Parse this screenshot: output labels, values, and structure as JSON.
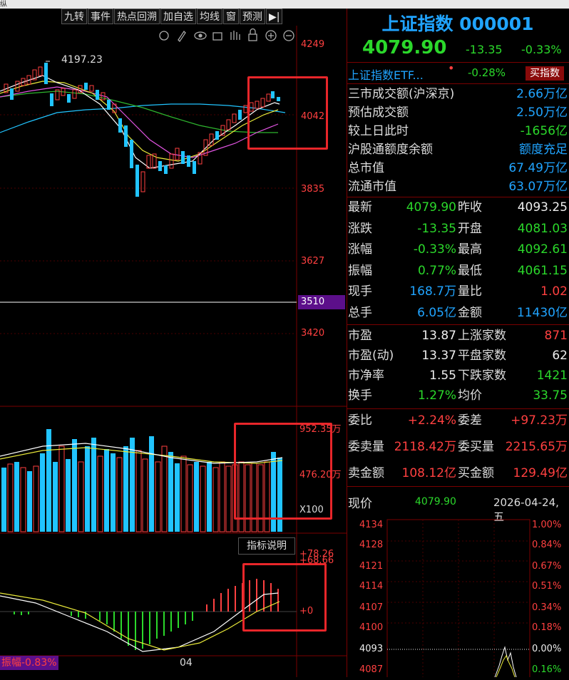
{
  "window": {
    "title_fragment": "纵"
  },
  "toolbar": {
    "buttons": [
      "九转",
      "事件",
      "热点回溯",
      "加自选",
      "均线",
      "窗",
      "预测"
    ],
    "arrow": "▶|"
  },
  "chart": {
    "peak_label": "4197.23",
    "price_axis": [
      "4249",
      "4042",
      "3835",
      "3627",
      "3510",
      "3420"
    ],
    "volume_axis": [
      "952.35万",
      "476.20万",
      "X100"
    ],
    "macd_axis": [
      "+78.26",
      "+68.66",
      "+0"
    ],
    "indicator_button": "指标说明",
    "amplitude_label": "振幅-0.83%",
    "date_label": "04",
    "tool_icons": [
      "gear-icon",
      "pen-icon",
      "eye-icon",
      "basket-icon",
      "hand-icon",
      "lock-icon",
      "zoom-in-icon",
      "zoom-out-icon"
    ]
  },
  "header": {
    "name": "上证指数",
    "code": "000001",
    "price": "4079.90",
    "change": "-13.35",
    "change_pct": "-0.33%",
    "etf_name": "上证指数ETF...",
    "etf_dot": "•",
    "etf_pct": "-0.28%",
    "buy_button": "买指数"
  },
  "market": [
    {
      "label": "三市成交额(沪深京)",
      "value": "2.66万亿",
      "color": "blue"
    },
    {
      "label": "预估成交额",
      "value": "2.50万亿",
      "color": "blue"
    },
    {
      "label": "较上日此时",
      "value": "-1656亿",
      "color": "grn"
    },
    {
      "label": "沪股通额度余额",
      "value": "额度充足",
      "color": "blue"
    },
    {
      "label": "总市值",
      "value": "67.49万亿",
      "color": "blue"
    },
    {
      "label": "流通市值",
      "value": "63.07万亿",
      "color": "blue"
    }
  ],
  "quote": [
    {
      "l1": "最新",
      "v1": "4079.90",
      "c1": "grn",
      "l2": "昨收",
      "v2": "4093.25",
      "c2": "wht"
    },
    {
      "l1": "涨跌",
      "v1": "-13.35",
      "c1": "grn",
      "l2": "开盘",
      "v2": "4081.03",
      "c2": "grn"
    },
    {
      "l1": "涨幅",
      "v1": "-0.33%",
      "c1": "grn",
      "l2": "最高",
      "v2": "4092.61",
      "c2": "grn"
    },
    {
      "l1": "振幅",
      "v1": "0.77%",
      "c1": "grn",
      "l2": "最低",
      "v2": "4061.15",
      "c2": "grn"
    },
    {
      "l1": "现手",
      "v1": "168.7万",
      "c1": "blue",
      "l2": "量比",
      "v2": "1.02",
      "c2": "red"
    },
    {
      "l1": "总手",
      "v1": "6.05亿",
      "c1": "blue",
      "l2": "金额",
      "v2": "11430亿",
      "c2": "blue"
    }
  ],
  "valuation": [
    {
      "l1": "市盈",
      "v1": "13.87",
      "c1": "wht",
      "l2": "上涨家数",
      "v2": "871",
      "c2": "red"
    },
    {
      "l1": "市盈(动)",
      "v1": "13.37",
      "c1": "wht",
      "l2": "平盘家数",
      "v2": "62",
      "c2": "wht"
    },
    {
      "l1": "市净率",
      "v1": "1.55",
      "c1": "wht",
      "l2": "下跌家数",
      "v2": "1421",
      "c2": "grn"
    },
    {
      "l1": "换手",
      "v1": "1.27%",
      "c1": "grn",
      "l2": "均价",
      "v2": "33.75",
      "c2": "grn"
    }
  ],
  "orders": {
    "r1": {
      "l1": "委比",
      "v1": "+2.24%",
      "l2": "委差",
      "v2": "+97.23万"
    },
    "r2": {
      "l1": "委卖量",
      "v1": "2118.42万",
      "l2": "委买量",
      "v2": "2215.65万"
    },
    "r3": {
      "l1": "卖金额",
      "v1": "108.12亿",
      "l2": "买金额",
      "v2": "129.49亿"
    }
  },
  "intraday": {
    "label": "现价",
    "price": "4079.90",
    "date": "2026-04-24,五",
    "left_axis": [
      "4134",
      "4128",
      "4121",
      "4114",
      "4107",
      "4100",
      "4093",
      "4087"
    ],
    "right_axis": [
      "1.00%",
      "0.84%",
      "0.67%",
      "0.51%",
      "0.34%",
      "0.18%",
      "0.00%",
      "0.16%"
    ]
  },
  "colors": {
    "up": "#ff4040",
    "down": "#2bd82b",
    "accent": "#20a4ff",
    "flat": "#eeeeee",
    "box": "#e8262a"
  }
}
